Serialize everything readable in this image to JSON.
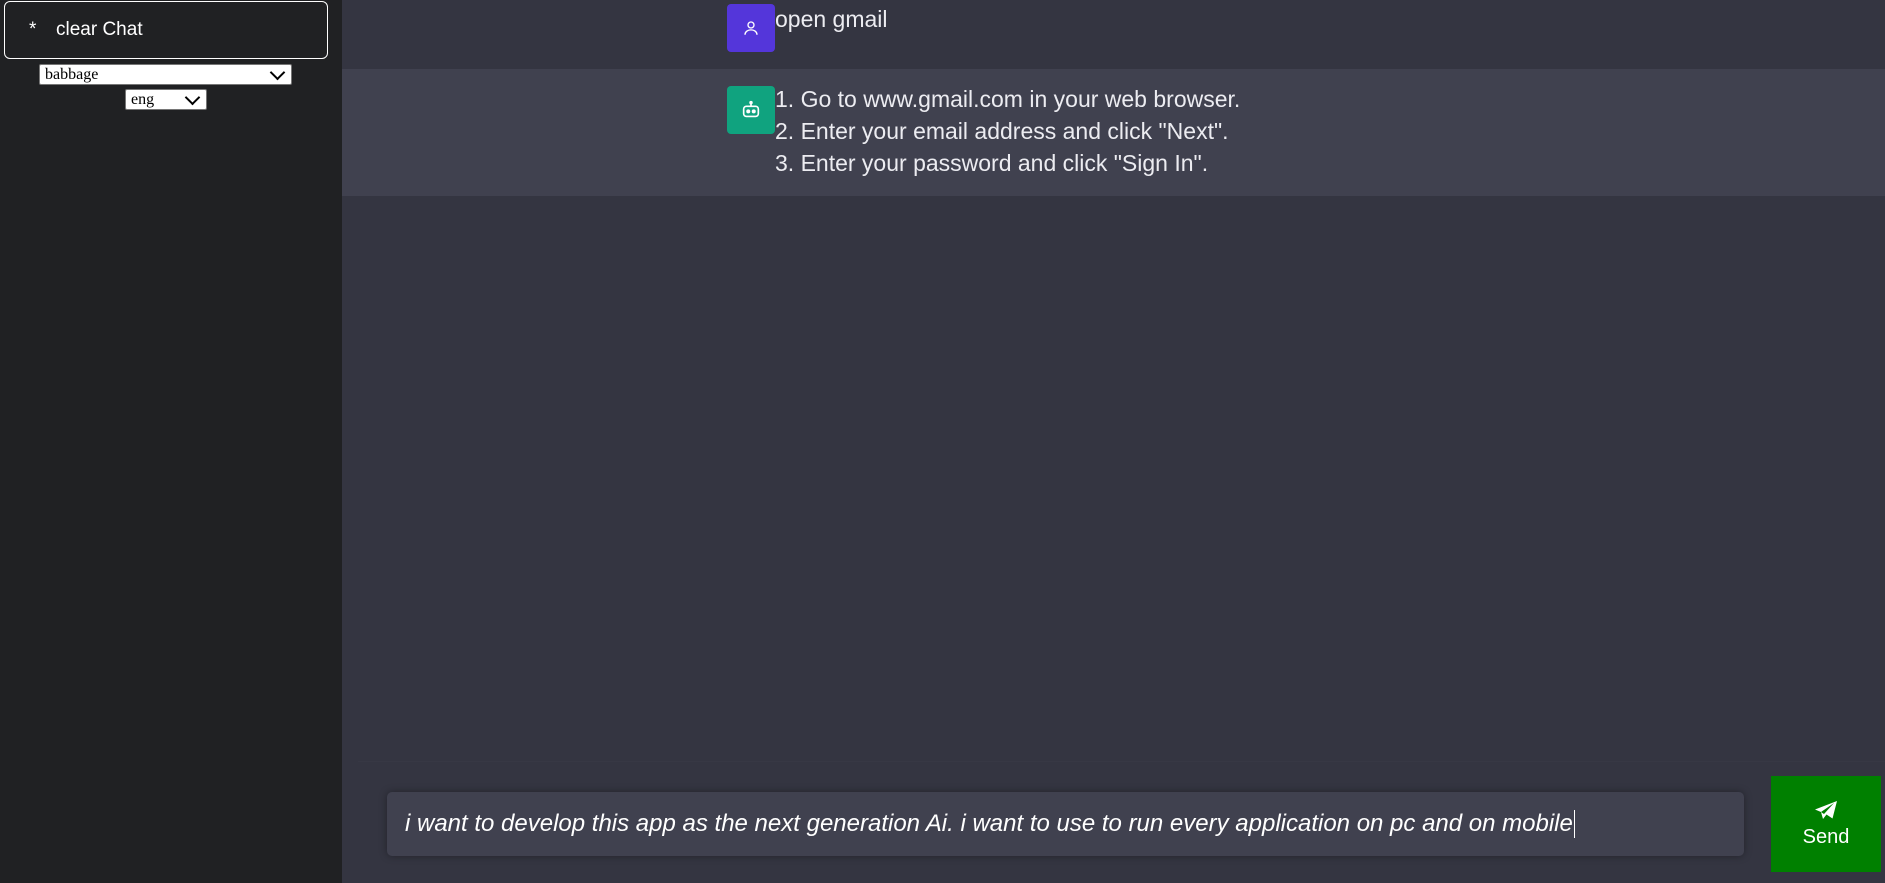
{
  "sidebar": {
    "clear_button": {
      "icon": "*",
      "label": "clear Chat"
    },
    "model_select": {
      "value": "babbage"
    },
    "language_select": {
      "value": "eng"
    }
  },
  "messages": [
    {
      "role": "user",
      "icon": "user-icon",
      "text": "open gmail"
    },
    {
      "role": "bot",
      "icon": "robot-icon",
      "lines": [
        "1. Go to www.gmail.com in your web browser.",
        "2. Enter your email address and click \"Next\".",
        "3. Enter your password and click \"Sign In\"."
      ]
    }
  ],
  "composer": {
    "input_value": "i want to develop this app as the next generation Ai. i want to use to run every application on pc and on mobile",
    "send_label": "Send",
    "send_icon": "paper-plane-icon"
  },
  "colors": {
    "sidebar_bg": "#202123",
    "main_bg": "#343541",
    "bot_row_bg": "#40414f",
    "user_avatar": "#5436da",
    "bot_avatar": "#10a37f",
    "send_button": "#008000"
  }
}
